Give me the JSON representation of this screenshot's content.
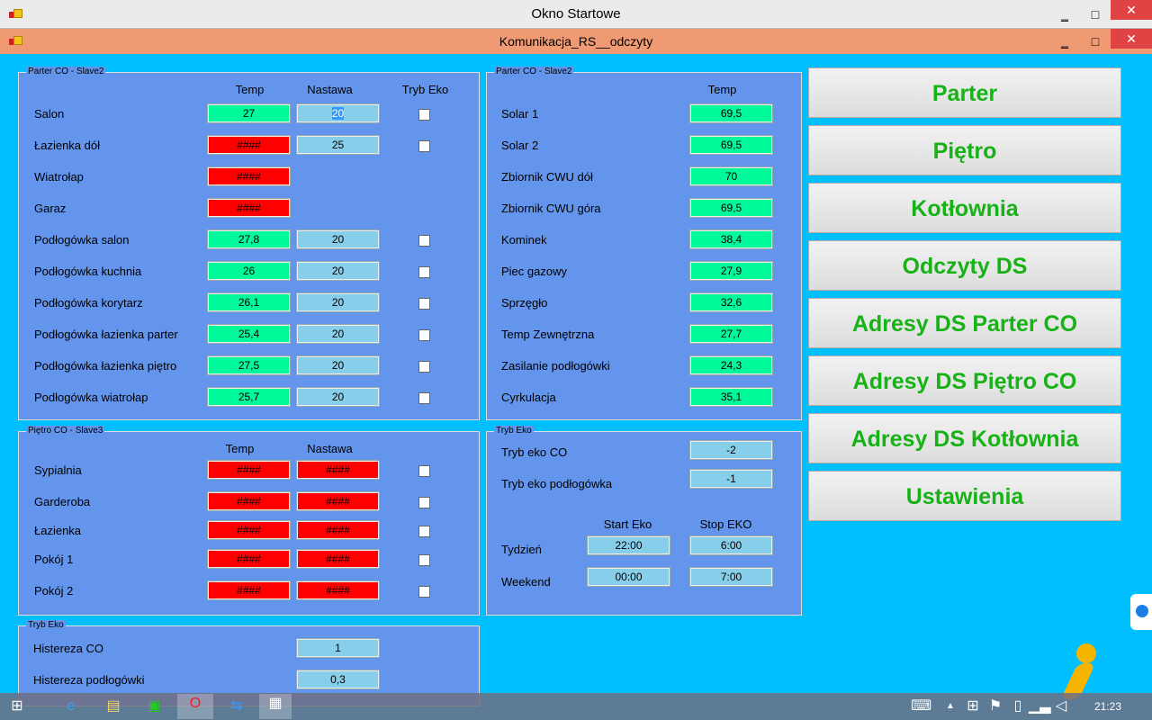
{
  "window": {
    "title": "Okno Startowe",
    "child_title": "Komunikacja_RS__odczyty",
    "minimize": "‗",
    "maximize": "□",
    "close": "✕"
  },
  "colors": {
    "ok": "#00FA9A",
    "error": "#FF0000",
    "setpoint": "#87CEEB",
    "panel": "#6495ED",
    "background": "#00BFFF",
    "nav_text": "#16B216"
  },
  "parter": {
    "legend": "Parter CO - Slave2",
    "headers": {
      "temp": "Temp",
      "nastawa": "Nastawa",
      "eko": "Tryb Eko"
    },
    "rows": [
      {
        "label": "Salon",
        "temp": "27",
        "status": "ok",
        "nastawa": "20",
        "eko": false
      },
      {
        "label": "Łazienka dół",
        "temp": "####",
        "status": "error",
        "nastawa": "25",
        "eko": false
      },
      {
        "label": "Wiatrołap",
        "temp": "####",
        "status": "error"
      },
      {
        "label": "Garaz",
        "temp": "####",
        "status": "error"
      },
      {
        "label": "Podłogówka salon",
        "temp": "27,8",
        "status": "ok",
        "nastawa": "20",
        "eko": false
      },
      {
        "label": "Podłogówka kuchnia",
        "temp": "26",
        "status": "ok",
        "nastawa": "20",
        "eko": false
      },
      {
        "label": "Podłogówka korytarz",
        "temp": "26,1",
        "status": "ok",
        "nastawa": "20",
        "eko": false
      },
      {
        "label": "Podłogówka łazienka parter",
        "temp": "25,4",
        "status": "ok",
        "nastawa": "20",
        "eko": false
      },
      {
        "label": "Podłogówka łazienka piętro",
        "temp": "27,5",
        "status": "ok",
        "nastawa": "20",
        "eko": false
      },
      {
        "label": "Podłogówka wiatrołap",
        "temp": "25,7",
        "status": "ok",
        "nastawa": "20",
        "eko": false
      }
    ]
  },
  "kotlownia": {
    "legend": "Parter CO - Slave2",
    "headers": {
      "temp": "Temp"
    },
    "rows": [
      {
        "label": "Solar 1",
        "temp": "69,5"
      },
      {
        "label": "Solar 2",
        "temp": "69,5"
      },
      {
        "label": "Zbiornik CWU dół",
        "temp": "70"
      },
      {
        "label": "Zbiornik CWU góra",
        "temp": "69,5"
      },
      {
        "label": "Kominek",
        "temp": "38,4"
      },
      {
        "label": "Piec gazowy",
        "temp": "27,9"
      },
      {
        "label": "Sprzęgło",
        "temp": "32,6"
      },
      {
        "label": "Temp Zewnętrzna",
        "temp": "27,7"
      },
      {
        "label": "Zasilanie podłogówki",
        "temp": "24,3"
      },
      {
        "label": "Cyrkulacja",
        "temp": "35,1"
      }
    ]
  },
  "pietro": {
    "legend": "Piętro CO - Slave3",
    "headers": {
      "temp": "Temp",
      "nastawa": "Nastawa"
    },
    "rows": [
      {
        "label": "Sypialnia",
        "temp": "####",
        "nastawa": "####",
        "eko": false
      },
      {
        "label": "Garderoba",
        "temp": "####",
        "nastawa": "####",
        "eko": false
      },
      {
        "label": "Łazienka",
        "temp": "####",
        "nastawa": "####",
        "eko": false
      },
      {
        "label": "Pokój 1",
        "temp": "####",
        "nastawa": "####",
        "eko": false
      },
      {
        "label": "Pokój 2",
        "temp": "####",
        "nastawa": "####",
        "eko": false
      }
    ]
  },
  "histereza": {
    "legend": "Tryb Eko",
    "rows": [
      {
        "label": "Histereza CO",
        "value": "1"
      },
      {
        "label": "Histereza podłogówki",
        "value": "0,3"
      }
    ]
  },
  "tryb_eko": {
    "legend": "Tryb Eko",
    "co_label": "Tryb eko CO",
    "co_value": "-2",
    "podl_label": "Tryb eko podłogówka",
    "podl_value": "-1",
    "start_header": "Start Eko",
    "stop_header": "Stop EKO",
    "tydzien_label": "Tydzień",
    "tydzien_start": "22:00",
    "tydzien_stop": "6:00",
    "weekend_label": "Weekend",
    "weekend_start": "00:00",
    "weekend_stop": "7:00"
  },
  "nav": [
    "Parter",
    "Piętro",
    "Kotłownia",
    "Odczyty DS",
    "Adresy DS Parter CO",
    "Adresy DS Piętro CO",
    "Adresy DS Kotłownia",
    "Ustawienia"
  ],
  "taskbar": {
    "clock": "21:23"
  }
}
